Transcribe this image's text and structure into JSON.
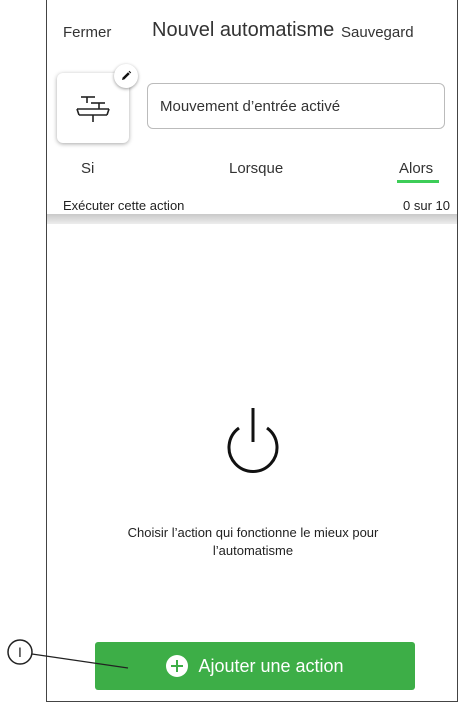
{
  "header": {
    "close_label": "Fermer",
    "title": "Nouvel automatisme",
    "save_label": "Sauvegard"
  },
  "automation": {
    "icon": "motion-sensor-icon",
    "name_value": "Mouvement d’entrée activé"
  },
  "tabs": [
    {
      "label": "Si",
      "active": false
    },
    {
      "label": "Lorsque",
      "active": false
    },
    {
      "label": "Alors",
      "active": true
    }
  ],
  "actions": {
    "section_label": "Exécuter cette action",
    "count_text": "0 sur 10"
  },
  "empty_state": {
    "icon": "power-icon",
    "hint": "Choisir l’action qui fonctionne le mieux pour l’automatisme"
  },
  "add_button": {
    "icon": "plus-circle-icon",
    "label": "Ajouter une action"
  },
  "callout": {
    "label": "I"
  },
  "colors": {
    "accent": "#3dcd58",
    "button": "#3dae47"
  }
}
